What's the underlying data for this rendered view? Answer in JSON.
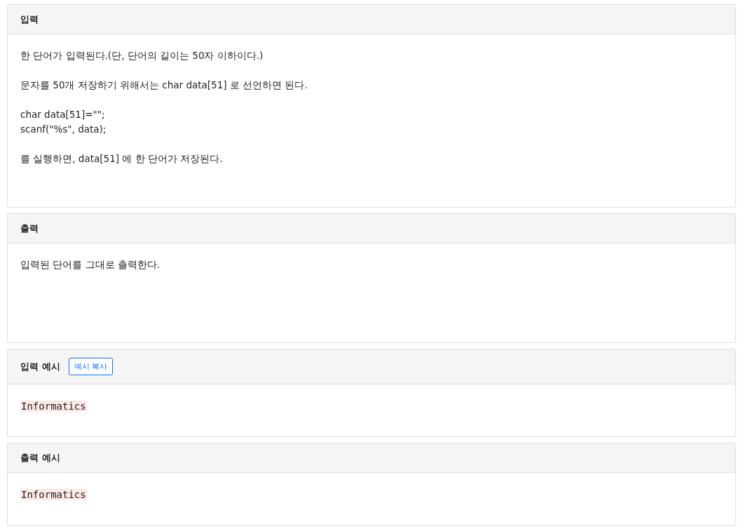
{
  "panels": [
    {
      "title": "입력",
      "kind": "text",
      "paragraphs": [
        [
          "한 단어가 입력된다.(단, 단어의 길이는 50자 이하이다.)"
        ],
        [
          "문자를 50개 저장하기 위해서는 char data[51] 로 선언하면 된다."
        ],
        [
          "char data[51]=\"\";",
          "scanf(\"%s\", data);"
        ],
        [
          "를 실행하면, data[51] 에 한 단어가 저장된다."
        ]
      ]
    },
    {
      "title": "출력",
      "kind": "text",
      "paragraphs": [
        [
          "입력된 단어를 그대로 출력한다."
        ]
      ]
    },
    {
      "title": "입력 예시",
      "copy_button": "예시 복사",
      "kind": "code",
      "code": "Informatics"
    },
    {
      "title": "출력 예시",
      "kind": "code",
      "code": "Informatics"
    }
  ]
}
